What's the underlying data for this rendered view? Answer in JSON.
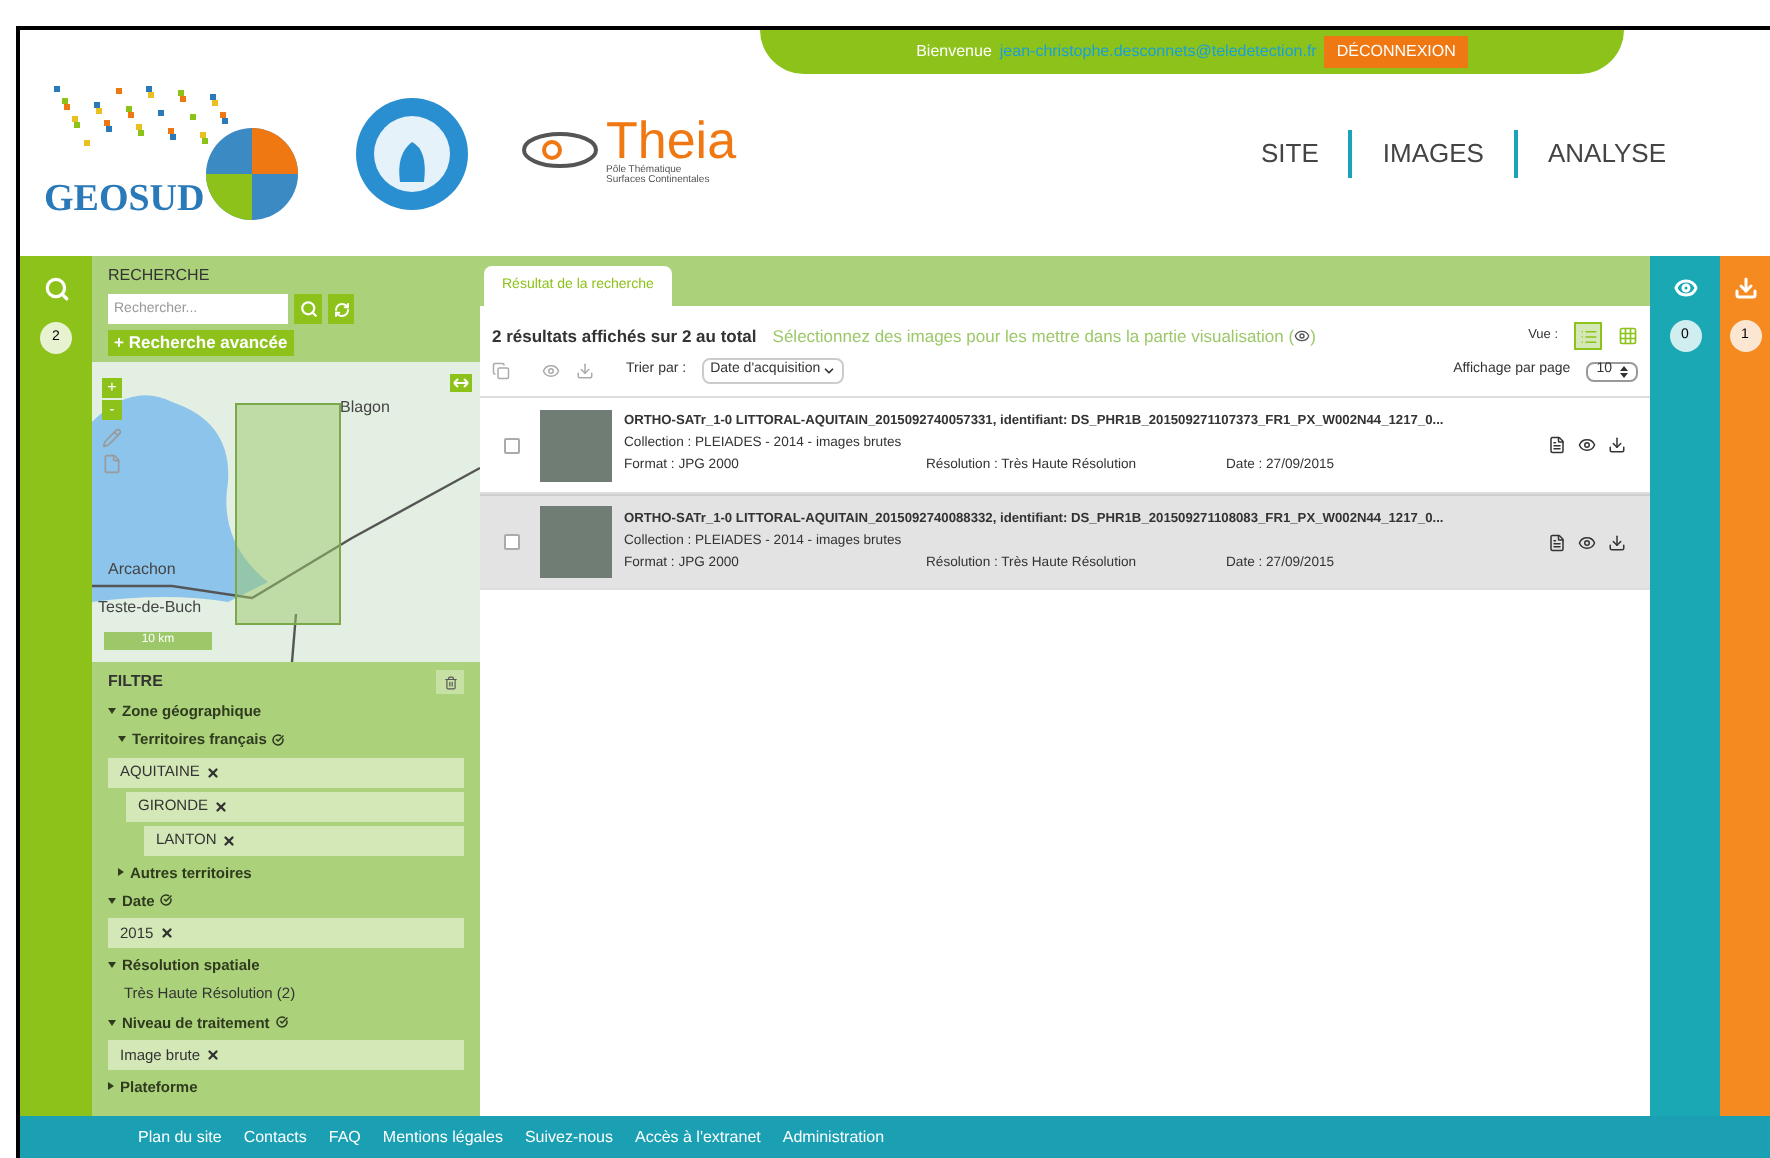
{
  "header": {
    "welcome": "Bienvenue",
    "user": "jean-christophe.desconnets@teledetection.fr",
    "logout": "DÉCONNEXION",
    "logos": {
      "geosud": "GEOSUD",
      "theia": "Theia",
      "theia_sub1": "Pôle Thématique",
      "theia_sub2": "Surfaces Continentales"
    },
    "nav": [
      "SITE",
      "IMAGES",
      "ANALYSE"
    ]
  },
  "left_rail": {
    "count": "2"
  },
  "search": {
    "title": "RECHERCHE",
    "placeholder": "Rechercher...",
    "advanced": "+ Recherche avancée",
    "map": {
      "labels": [
        "Blagon",
        "Arcachon",
        "Teste-de-Buch"
      ],
      "scale": "10 km",
      "zoom_in": "+",
      "zoom_out": "-"
    }
  },
  "filter": {
    "title": "FILTRE",
    "items": [
      {
        "kind": "group",
        "label": "Zone géographique",
        "expanded": true,
        "children": [
          {
            "kind": "group",
            "label": "Territoires français",
            "expanded": true,
            "children": [
              {
                "kind": "tag",
                "label": "AQUITAINE",
                "children": [
                  {
                    "kind": "tag",
                    "label": "GIRONDE",
                    "children": [
                      {
                        "kind": "tag",
                        "label": "LANTON"
                      }
                    ]
                  }
                ]
              }
            ]
          },
          {
            "kind": "group",
            "label": "Autres territoires",
            "expanded": false
          }
        ]
      },
      {
        "kind": "group",
        "label": "Date",
        "expanded": true,
        "children": [
          {
            "kind": "tag",
            "label": "2015"
          }
        ]
      },
      {
        "kind": "group",
        "label": "Résolution spatiale",
        "expanded": true,
        "children": [
          {
            "kind": "option",
            "label": "Très Haute Résolution (2)"
          }
        ]
      },
      {
        "kind": "group",
        "label": "Niveau de traitement",
        "expanded": true,
        "children": [
          {
            "kind": "tag",
            "label": "Image brute"
          }
        ]
      },
      {
        "kind": "group",
        "label": "Plateforme",
        "expanded": false
      }
    ]
  },
  "results": {
    "tab": "Résultat de la recherche",
    "summary": "2 résultats affichés sur 2 au total",
    "hint": "Sélectionnez des images pour les mettre dans la partie visualisation (",
    "hint_end": ")",
    "view_label": "Vue :",
    "sort_label": "Trier par :",
    "sort_value": "Date d'acquisition",
    "per_page_label": "Affichage par page",
    "per_page": "10",
    "rows": [
      {
        "title": "ORTHO-SATr_1-0 LITTORAL-AQUITAIN_2015092740057331, identifiant: DS_PHR1B_201509271107373_FR1_PX_W002N44_1217_0...",
        "collection": "Collection : PLEIADES - 2014 - images brutes",
        "format": "Format : JPG 2000",
        "resolution": "Résolution : Très Haute Résolution",
        "date": "Date : 27/09/2015",
        "checked": false,
        "selected": false
      },
      {
        "title": "ORTHO-SATr_1-0 LITTORAL-AQUITAIN_2015092740088332, identifiant: DS_PHR1B_201509271108083_FR1_PX_W002N44_1217_0...",
        "collection": "Collection : PLEIADES - 2014 - images brutes",
        "format": "Format : JPG 2000",
        "resolution": "Résolution : Très Haute Résolution",
        "date": "Date : 27/09/2015",
        "checked": false,
        "selected": true
      }
    ]
  },
  "view_rail": {
    "count": "0"
  },
  "download_rail": {
    "count": "1"
  },
  "footer": [
    "Plan du site",
    "Contacts",
    "FAQ",
    "Mentions légales",
    "Suivez-nous",
    "Accès à l'extranet",
    "Administration"
  ]
}
